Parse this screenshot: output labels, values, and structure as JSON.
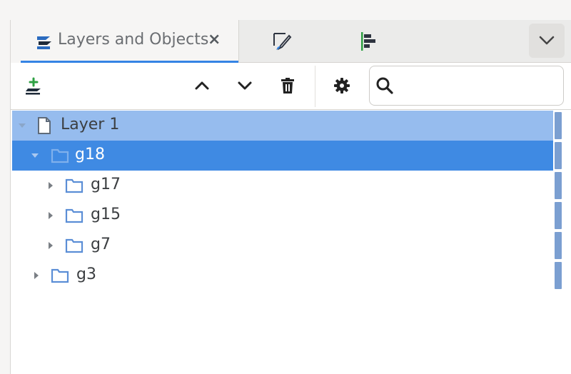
{
  "tabs": [
    {
      "label": "Layers and Objects",
      "close": "×",
      "active": true,
      "icon": "layers-icon"
    },
    {
      "label": "",
      "icon": "fill-stroke-icon"
    },
    {
      "label": "",
      "icon": "align-icon"
    }
  ],
  "tab_menu_icon": "chevron-down-icon",
  "toolbar": {
    "add_layer_icon": "add-layer-icon",
    "raise_icon": "chevron-up-icon",
    "lower_icon": "chevron-down-icon",
    "delete_icon": "trash-icon",
    "settings_icon": "gear-icon",
    "search_placeholder": "",
    "search_value": ""
  },
  "tree": [
    {
      "label": "Layer 1",
      "type": "layer",
      "depth": 0,
      "expanded": true
    },
    {
      "label": "g18",
      "type": "group",
      "depth": 1,
      "expanded": true,
      "selected": true
    },
    {
      "label": "g17",
      "type": "group",
      "depth": 2,
      "expanded": false
    },
    {
      "label": "g15",
      "type": "group",
      "depth": 2,
      "expanded": false
    },
    {
      "label": "g7",
      "type": "group",
      "depth": 2,
      "expanded": false
    },
    {
      "label": "g3",
      "type": "group",
      "depth": 1,
      "expanded": false
    }
  ],
  "colors": {
    "accent": "#3584e4",
    "layer_row": "#96bcee",
    "selected_row": "#3f8ae3",
    "folder_icon": "#5b8ed6"
  }
}
